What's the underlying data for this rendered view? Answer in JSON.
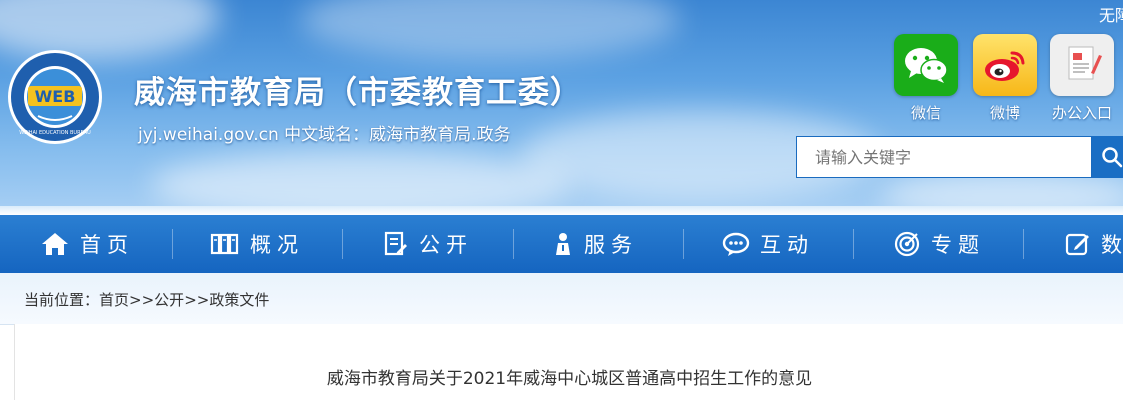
{
  "header": {
    "logo_text": "WEB",
    "logo_sub": "WEIHAI EDUCATION BUREAU",
    "site_title": "威海市教育局（市委教育工委）",
    "site_domain": "jyj.weihai.gov.cn 中文域名：威海市教育局.政务",
    "top_right_text": "无障",
    "quick_links": [
      {
        "label": "微信",
        "icon": "wechat-icon",
        "color": "#1aad19"
      },
      {
        "label": "微博",
        "icon": "weibo-icon",
        "color": "#e6162d"
      },
      {
        "label": "办公入口",
        "icon": "office-document-icon",
        "color": "#f0f0f0"
      }
    ],
    "search": {
      "placeholder": "请输入关键字",
      "icon": "search-icon"
    }
  },
  "nav": {
    "items": [
      {
        "label": "首页",
        "icon": "home-icon"
      },
      {
        "label": "概况",
        "icon": "books-icon"
      },
      {
        "label": "公开",
        "icon": "document-edit-icon"
      },
      {
        "label": "服务",
        "icon": "person-icon"
      },
      {
        "label": "互动",
        "icon": "chat-icon"
      },
      {
        "label": "专题",
        "icon": "target-icon"
      },
      {
        "label": "数",
        "icon": "edit-icon"
      }
    ],
    "color": "#1a6ec4"
  },
  "breadcrumb": {
    "prefix": "当前位置：",
    "items": [
      "首页",
      "公开",
      "政策文件"
    ],
    "separator": ">>"
  },
  "article": {
    "title": "威海市教育局关于2021年威海中心城区普通高中招生工作的意见"
  }
}
